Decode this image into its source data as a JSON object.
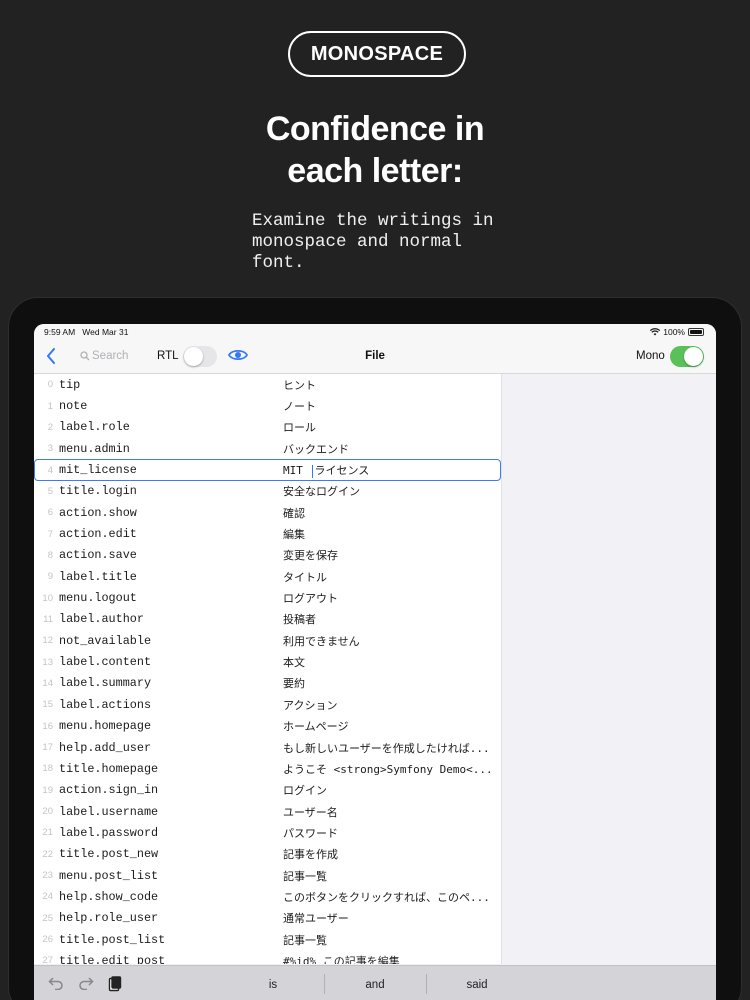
{
  "promo": {
    "badge": "MONOSPACE",
    "headline_line1": "Confidence in",
    "headline_line2": "each letter:",
    "subtext": "Examine the writings in monospace and normal font."
  },
  "statusbar": {
    "time": "9:59 AM",
    "date": "Wed Mar 31",
    "battery": "100%"
  },
  "toolbar": {
    "search_placeholder": "Search",
    "rtl_label": "RTL",
    "rtl_enabled": false,
    "title": "File",
    "mono_label": "Mono",
    "mono_enabled": true,
    "accent_color": "#3478f6",
    "toggle_on_color": "#5ac05a"
  },
  "rows": [
    {
      "num": "0",
      "key": "tip",
      "value": "ヒント"
    },
    {
      "num": "1",
      "key": "note",
      "value": "ノート"
    },
    {
      "num": "2",
      "key": "label.role",
      "value": "ロール"
    },
    {
      "num": "3",
      "key": "menu.admin",
      "value": "バックエンド"
    },
    {
      "num": "4",
      "key": "mit_license",
      "value": "MIT ライセンス",
      "selected": true
    },
    {
      "num": "5",
      "key": "title.login",
      "value": "安全なログイン"
    },
    {
      "num": "6",
      "key": "action.show",
      "value": "確認"
    },
    {
      "num": "7",
      "key": "action.edit",
      "value": "編集"
    },
    {
      "num": "8",
      "key": "action.save",
      "value": "変更を保存"
    },
    {
      "num": "9",
      "key": "label.title",
      "value": "タイトル"
    },
    {
      "num": "10",
      "key": "menu.logout",
      "value": "ログアウト"
    },
    {
      "num": "11",
      "key": "label.author",
      "value": "投稿者"
    },
    {
      "num": "12",
      "key": "not_available",
      "value": "利用できません"
    },
    {
      "num": "13",
      "key": "label.content",
      "value": "本文"
    },
    {
      "num": "14",
      "key": "label.summary",
      "value": "要約"
    },
    {
      "num": "15",
      "key": "label.actions",
      "value": "アクション"
    },
    {
      "num": "16",
      "key": "menu.homepage",
      "value": "ホームページ"
    },
    {
      "num": "17",
      "key": "help.add_user",
      "value": "もし新しいユーザーを作成したければ..."
    },
    {
      "num": "18",
      "key": "title.homepage",
      "value": "ようこそ <strong>Symfony Demo<..."
    },
    {
      "num": "19",
      "key": "action.sign_in",
      "value": "ログイン"
    },
    {
      "num": "20",
      "key": "label.username",
      "value": "ユーザー名"
    },
    {
      "num": "21",
      "key": "label.password",
      "value": "パスワード"
    },
    {
      "num": "22",
      "key": "title.post_new",
      "value": "記事を作成"
    },
    {
      "num": "23",
      "key": "menu.post_list",
      "value": "記事一覧"
    },
    {
      "num": "24",
      "key": "help.show_code",
      "value": "このボタンをクリックすれば、このペ..."
    },
    {
      "num": "25",
      "key": "help.role_user",
      "value": "通常ユーザー"
    },
    {
      "num": "26",
      "key": "title.post_list",
      "value": "記事一覧"
    },
    {
      "num": "27",
      "key": "title.edit_post",
      "value": "#%id% この記事を編集"
    }
  ],
  "keyboard": {
    "suggestions": [
      "is",
      "and",
      "said"
    ]
  }
}
